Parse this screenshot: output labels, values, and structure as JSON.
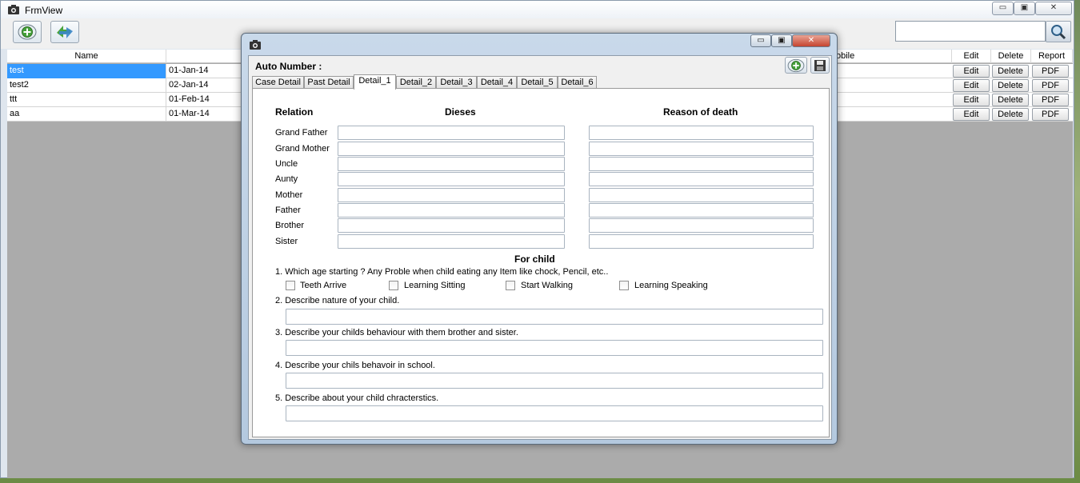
{
  "main_window": {
    "title": "FrmView",
    "search_value": "",
    "columns": [
      "Name",
      "",
      "obile",
      "Edit",
      "Delete",
      "Report"
    ],
    "rows": [
      {
        "name": "test",
        "date": "01-Jan-14",
        "edit": "Edit",
        "delete": "Delete",
        "report": "PDF"
      },
      {
        "name": "test2",
        "date": "02-Jan-14",
        "edit": "Edit",
        "delete": "Delete",
        "report": "PDF"
      },
      {
        "name": "ttt",
        "date": "01-Feb-14",
        "edit": "Edit",
        "delete": "Delete",
        "report": "PDF"
      },
      {
        "name": "aa",
        "date": "01-Mar-14",
        "edit": "Edit",
        "delete": "Delete",
        "report": "PDF"
      }
    ],
    "controls": {
      "minimize": "▭",
      "restore": "▣",
      "close": "✕"
    }
  },
  "dialog": {
    "controls": {
      "minimize": "▭",
      "restore": "▣",
      "close": "✕"
    },
    "auto_number_label": "Auto Number :",
    "tabs": [
      "Case Detail",
      "Past Detail",
      "Detail_1",
      "Detail_2",
      "Detail_3",
      "Detail_4",
      "Detail_5",
      "Detail_6"
    ],
    "active_tab": "Detail_1",
    "headers": {
      "relation": "Relation",
      "dieses": "Dieses",
      "reason": "Reason of death"
    },
    "relations": [
      "Grand Father",
      "Grand Mother",
      "Uncle",
      "Aunty",
      "Mother",
      "Father",
      "Brother",
      "Sister"
    ],
    "for_child_title": "For child",
    "q1": "1. Which age starting ? Any Proble when child eating any Item  like chock, Pencil, etc..",
    "checkboxes": [
      "Teeth Arrive",
      "Learning Sitting",
      "Start Walking",
      "Learning Speaking"
    ],
    "q2": "2. Describe nature of your child.",
    "q3": "3. Describe your childs behaviour with them brother and sister.",
    "q4": "4. Describe your chils behavoir in school.",
    "q5": "5. Describe about your child chracterstics."
  },
  "colors": {
    "selection": "#3399ff",
    "dialog_frame": "#b4c9df",
    "close_button": "#c5442f"
  },
  "icons": [
    "camera-icon",
    "add-icon",
    "refresh-arrows-icon",
    "search-icon",
    "save-icon"
  ]
}
